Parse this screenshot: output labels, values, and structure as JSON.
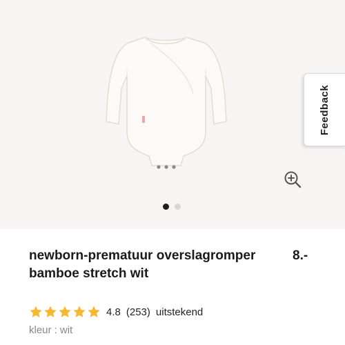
{
  "feedback": {
    "label": "Feedback"
  },
  "product": {
    "title": "newborn-prematuur overslagromper bamboe stretch wit",
    "price": "8.-"
  },
  "gallery": {
    "image_count": 2,
    "active_index": 0,
    "zoom_icon": "zoom-in-icon"
  },
  "rating": {
    "stars": 5,
    "value": "4.8",
    "count": "(253)",
    "label": "uitstekend",
    "star_color": "#f5b82e"
  },
  "color": {
    "label": "kleur :",
    "value": "wit"
  }
}
